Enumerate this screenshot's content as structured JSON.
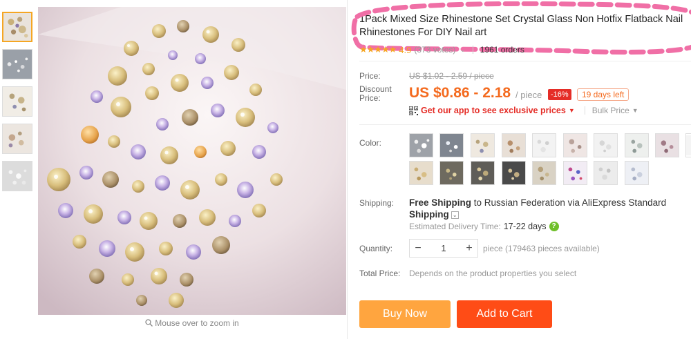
{
  "product": {
    "title": "1Pack Mixed Size Rhinestone Set Crystal Glass Non Hotfix Flatback Nail Rhinestones For DIY Nail art",
    "stars": "★★★★★",
    "rating": "4.9",
    "votes": "(373 votes)",
    "orders": "1961 orders"
  },
  "gallery": {
    "thumbnails": 5,
    "active_thumbnail": 1,
    "zoom_hint": "Mouse over to zoom in"
  },
  "price": {
    "label": "Price:",
    "original": "US $1.02 - 2.59 / piece",
    "discount_label_1": "Discount",
    "discount_label_2": "Price:",
    "discounted": "US $0.86 - 2.18",
    "unit": "/ piece",
    "discount_badge": "-16%",
    "days_left": "19 days left",
    "app_offer": "Get our app to see exclusive prices",
    "bulk_price": "Bulk Price"
  },
  "color": {
    "label": "Color:",
    "swatch_count": 17
  },
  "shipping": {
    "label": "Shipping:",
    "free": "Free Shipping",
    "to": "to Russian Federation via AliExpress Standard",
    "shipping_word": "Shipping",
    "est_label": "Estimated Delivery Time:",
    "est_days": "17-22 days"
  },
  "quantity": {
    "label": "Quantity:",
    "minus": "−",
    "value": "1",
    "plus": "+",
    "available": "piece (179463 pieces available)"
  },
  "total": {
    "label": "Total Price:",
    "value": "Depends on the product properties you select"
  },
  "actions": {
    "buy_now": "Buy Now",
    "add_to_cart": "Add to Cart"
  },
  "colors": {
    "accent_orange": "#f46a1e",
    "buy_now_bg": "#ffa53f",
    "add_to_cart_bg": "#ff4c16",
    "annotation_pink": "#f06fa6"
  }
}
